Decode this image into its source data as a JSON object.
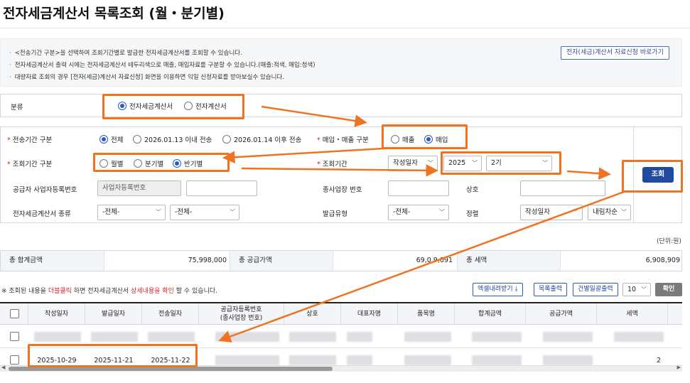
{
  "page": {
    "title": "전자세금계산서 목록조회 (월・분기별)"
  },
  "notice": {
    "lines": [
      "<전송기간 구분>을 선택하여 조회기간별로 발급한 전자세금계산서를 조회할 수 있습니다.",
      "전자세금계산서 출력 시에는 전자세금계산서 테두리색으로 매출, 매입자료를 구분할 수 있습니다.(매출:적색, 매입:청색)",
      "대량자료 조회의 경우 [전자(세금)계산서 자료신청] 화면을 이용하면 익일 신청자료를 받아보실수 있습니다."
    ],
    "shortcut_button": "전자(세금)계산서 자료신청 바로가기"
  },
  "category": {
    "label": "분류",
    "options": [
      "전자세금계산서",
      "전자계산서"
    ],
    "selected": "전자세금계산서"
  },
  "search": {
    "send_period": {
      "label": "전송기간 구분",
      "options": [
        "전체",
        "2026.01.13 이내 전송",
        "2026.01.14 이후 전송"
      ],
      "selected": "전체"
    },
    "trade_type": {
      "label": "매입・매출 구분",
      "options": [
        "매출",
        "매입"
      ],
      "selected": "매입"
    },
    "period_type": {
      "label": "조회기간 구분",
      "options": [
        "월별",
        "분기별",
        "반기별"
      ],
      "selected": "반기별"
    },
    "period": {
      "label": "조회기간",
      "date_basis": "작성일자",
      "year": "2025",
      "term": "2기"
    },
    "supplier_reg_no": {
      "label": "공급자 사업자등록번호",
      "type_value": "사업자등록번호",
      "value": ""
    },
    "branch_no": {
      "label": "종사업장 번호",
      "value": ""
    },
    "company_name": {
      "label": "상호",
      "value": ""
    },
    "invoice_kind": {
      "label": "전자세금계산서 종류",
      "select1": "-전체-",
      "select2": "-전체-"
    },
    "issue_type": {
      "label": "발급유형",
      "value": "-전체-"
    },
    "sort": {
      "label": "정렬",
      "field": "작성일자",
      "order": "내림차순"
    },
    "search_button": "조회"
  },
  "summary": {
    "unit": "(단위:원)",
    "total_label": "총 합계금액",
    "total_value": "75,998,000",
    "supply_label": "총 공급가액",
    "supply_value": "69,0 9,091",
    "tax_label": "총 세액",
    "tax_value": "6,908,909"
  },
  "hint": {
    "prefix": "※ 조회된 내용을 ",
    "dblclick": "더블클릭",
    "mid": " 하면 전자세금계산서 ",
    "detail": "상세내용을 확인",
    "suffix": " 할 수 있습니다."
  },
  "toolbar": {
    "excel": "엑셀내려받기",
    "print_list": "목록출력",
    "batch_print": "건별일괄출력",
    "page_size": "10",
    "confirm": "확인"
  },
  "table": {
    "headers": [
      "작성일자",
      "발급일자",
      "전송일자",
      "공급자등록번호\n(종사업장 번호)",
      "상호",
      "대표자명",
      "품목명",
      "합계금액",
      "공급가액",
      "세액"
    ],
    "rows": [
      {
        "written": "",
        "issued": "",
        "sent": "",
        "tail": ""
      },
      {
        "written": "2025-10-29",
        "issued": "2025-11-21",
        "sent": "2025-11-22",
        "tail": "2"
      }
    ]
  }
}
